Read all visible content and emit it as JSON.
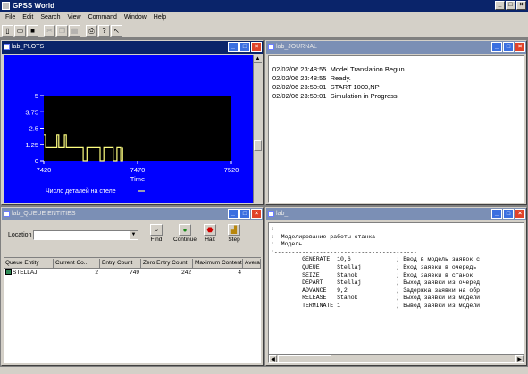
{
  "app": {
    "title": "GPSS World"
  },
  "menu": [
    "File",
    "Edit",
    "Search",
    "View",
    "Command",
    "Window",
    "Help"
  ],
  "toolbar": {
    "icons": [
      "new-icon",
      "open-icon",
      "save-icon",
      "cut-icon",
      "copy-icon",
      "paste-icon",
      "print-icon",
      "help-icon",
      "context-help-icon"
    ]
  },
  "plots": {
    "title": "lab_PLOTS",
    "chart_data": {
      "type": "line",
      "x": [
        7420,
        7421,
        7421,
        7427,
        7427,
        7428,
        7428,
        7431,
        7431,
        7432,
        7432,
        7441,
        7441,
        7443,
        7443,
        7450,
        7450,
        7452,
        7452,
        7457,
        7457,
        7459,
        7459,
        7461,
        7461,
        7462,
        7462
      ],
      "y": [
        2,
        2,
        1,
        1,
        2,
        2,
        1,
        1,
        2,
        2,
        1,
        1,
        0,
        0,
        1,
        1,
        0,
        0,
        1,
        1,
        0,
        0,
        1,
        1,
        0,
        0,
        1
      ],
      "xlim": [
        7420,
        7520
      ],
      "ylim": [
        0,
        5
      ],
      "xticks": [
        "7420",
        "7470",
        "7520"
      ],
      "yticks": [
        "5",
        "3.75",
        "2.5",
        "1.25",
        "0"
      ],
      "xlabel": "Time",
      "legend": "Число деталей на стеле",
      "colors": {
        "background": "#000000",
        "frame": "#0000ff",
        "line": "#ffff80",
        "text": "#ffffff"
      }
    }
  },
  "journal": {
    "title": "lab_JOURNAL",
    "lines": [
      "02/02/06 23:48:55  Model Translation Begun.",
      "02/02/06 23:48:55  Ready.",
      "02/02/06 23:50:01  START 1000,NP",
      "02/02/06 23:50:01  Simulation in Progress."
    ]
  },
  "queue": {
    "title": "lab_QUEUE ENTITIES",
    "location_label": "Location",
    "location_value": "",
    "buttons": [
      {
        "label": "Find",
        "icon": "magnifier-icon"
      },
      {
        "label": "Continue",
        "icon": "traffic-light-icon"
      },
      {
        "label": "Halt",
        "icon": "stop-icon"
      },
      {
        "label": "Step",
        "icon": "bar-chart-icon"
      }
    ],
    "columns": [
      "Queue Entity",
      "Current Co...",
      "Entry Count",
      "Zero Entry Count",
      "Maximum Content",
      "Averag"
    ],
    "rows": [
      [
        "STELLAJ",
        "2",
        "749",
        "242",
        "4",
        ""
      ]
    ]
  },
  "model": {
    "title": "lab_",
    "lines": [
      ";-----------------------------------------",
      ";  Моделирование работы станка",
      ";  Модель",
      ";-----------------------------------------",
      "         GENERATE  10,6             ; Ввод в модель заявок с",
      "         QUEUE     Stellaj          ; Вход заявки в очередь",
      "         SEIZE     Stanok           ; Вход заявки в станок",
      "         DEPART    Stellaj          ; Выход заявки из очеред",
      "         ADVANCE   9,2              ; Задержка заявки на обр",
      "         RELEASE   Stanok           ; Выход заявки из модели",
      "         TERMINATE 1                ; Вывод заявки из модели"
    ]
  }
}
